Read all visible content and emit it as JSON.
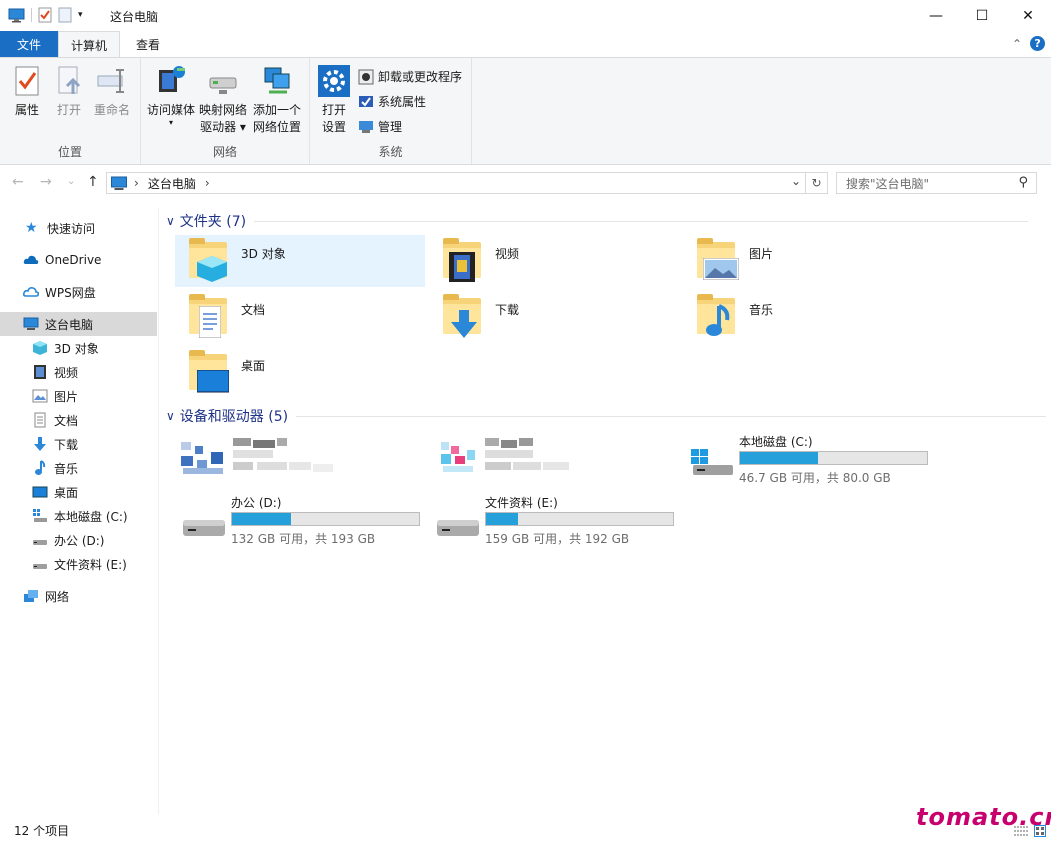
{
  "window": {
    "title": "这台电脑",
    "minimize": "—",
    "maximize": "☐",
    "close": "✕"
  },
  "tabs": {
    "file": "文件",
    "computer": "计算机",
    "view": "查看",
    "collapse": "⌃",
    "help": "?"
  },
  "ribbon": {
    "location": {
      "label": "位置",
      "properties": "属性",
      "open": "打开",
      "rename": "重命名"
    },
    "network": {
      "label": "网络",
      "media": "访问媒体",
      "map_line1": "映射网络",
      "map_line2": "驱动器",
      "add_line1": "添加一个",
      "add_line2": "网络位置"
    },
    "system": {
      "label": "系统",
      "settings_line1": "打开",
      "settings_line2": "设置",
      "uninstall": "卸载或更改程序",
      "sysprops": "系统属性",
      "manage": "管理"
    }
  },
  "nav": {
    "back": "←",
    "forward": "→",
    "recent": "⌄",
    "up": "↑",
    "path_sep": "›",
    "path": "这台电脑",
    "dropdown": "⌄",
    "refresh": "↻",
    "search_placeholder": "搜索\"这台电脑\"",
    "search_icon": "⚲"
  },
  "sidebar": {
    "quick": "快速访问",
    "onedrive": "OneDrive",
    "wps": "WPS网盘",
    "thispc": "这台电脑",
    "obj3d": "3D 对象",
    "video": "视频",
    "pictures": "图片",
    "docs": "文档",
    "downloads": "下载",
    "music": "音乐",
    "desktop": "桌面",
    "drive_c": "本地磁盘 (C:)",
    "drive_d": "办公 (D:)",
    "drive_e": "文件资料 (E:)",
    "network": "网络"
  },
  "folders_section": {
    "chevron": "∨",
    "title": "文件夹 (7)",
    "items": {
      "obj3d": "3D 对象",
      "video": "视频",
      "pictures": "图片",
      "docs": "文档",
      "downloads": "下载",
      "music": "音乐",
      "desktop": "桌面"
    }
  },
  "drives_section": {
    "chevron": "∨",
    "title": "设备和驱动器 (5)",
    "c": {
      "name": "本地磁盘 (C:)",
      "info": "46.7 GB 可用，共 80.0 GB",
      "used_fraction": 0.416
    },
    "d": {
      "name": "办公 (D:)",
      "info": "132 GB 可用，共 193 GB",
      "used_fraction": 0.316
    },
    "e": {
      "name": "文件资料 (E:)",
      "info": "159 GB 可用，共 192 GB",
      "used_fraction": 0.172
    }
  },
  "status": {
    "count": "12 个项目"
  },
  "watermark": "tomato.cm",
  "colors": {
    "accent": "#1a6fc4",
    "drive_fill": "#26a0da",
    "section_title": "#1e3287",
    "watermark": "#c8006e"
  }
}
